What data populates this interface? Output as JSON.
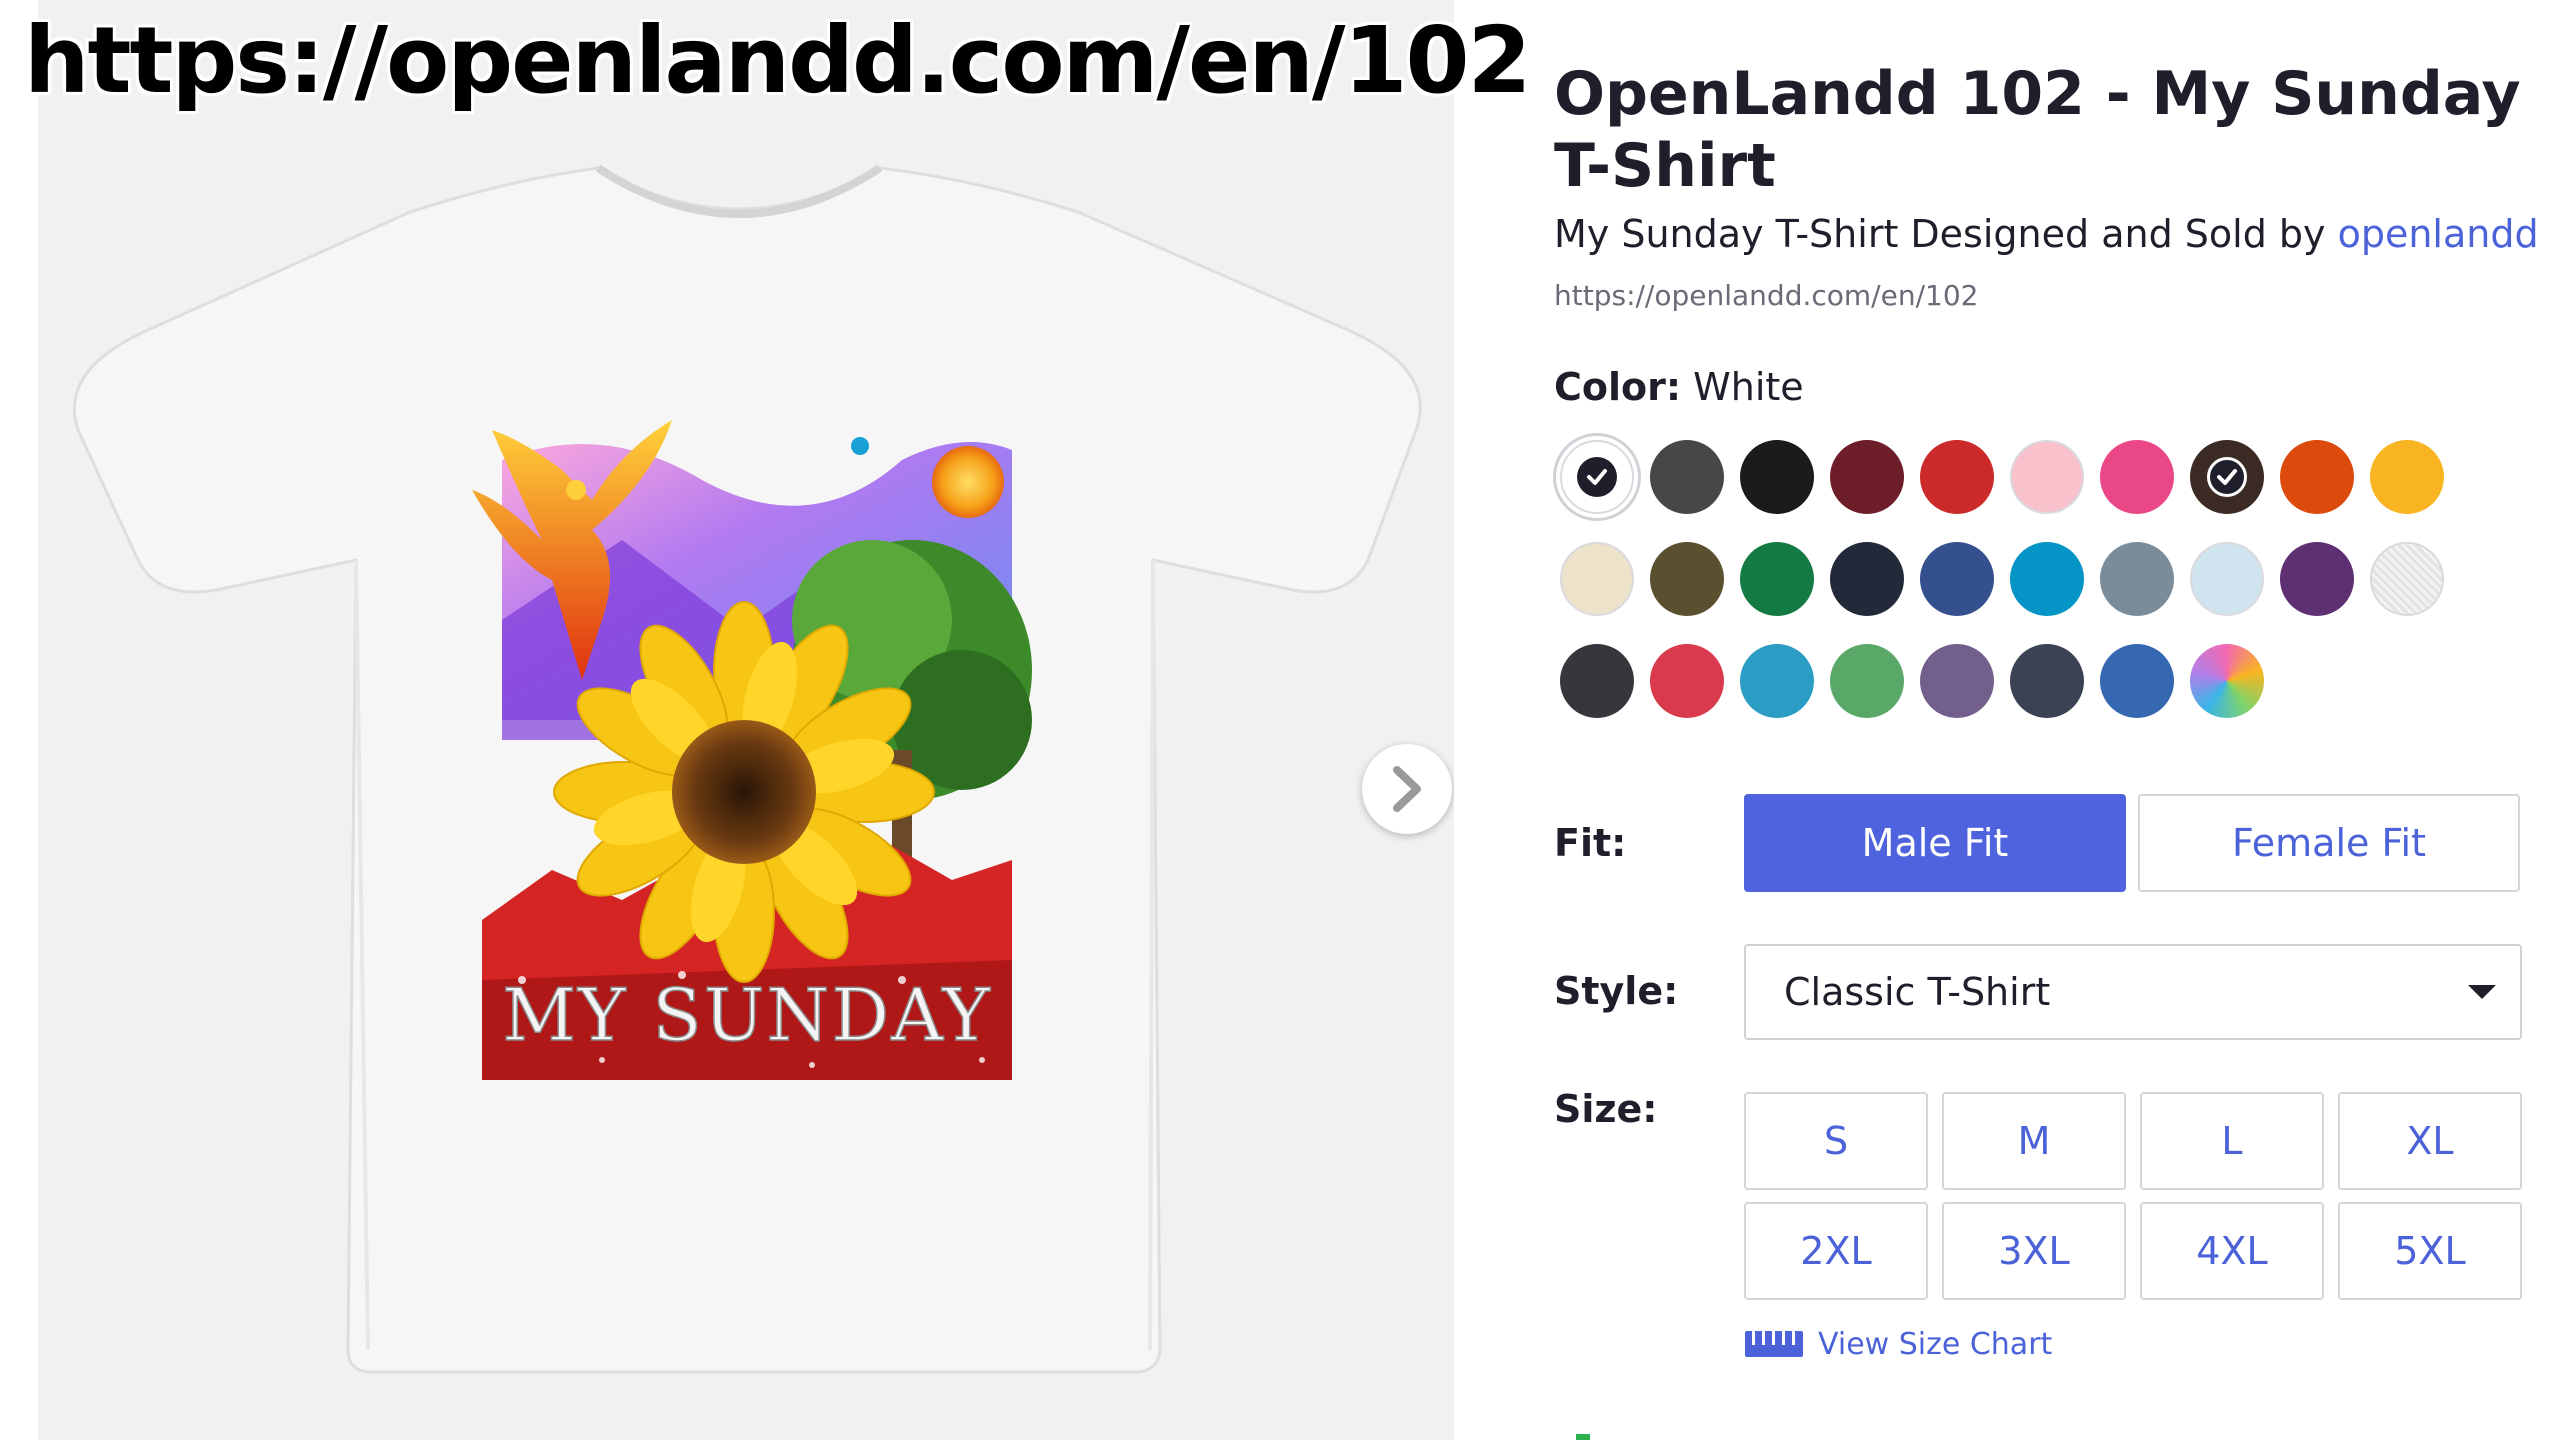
{
  "overlay_url": "https://openlandd.com/en/102",
  "product": {
    "title": "OpenLandd 102 - My Sunday T-Shirt",
    "subtitle_prefix": "My Sunday T-Shirt Designed and Sold by ",
    "seller": "openlandd",
    "source_url": "https://openlandd.com/en/102",
    "artwork_text": "MY SUNDAY"
  },
  "color": {
    "label": "Color:",
    "selected": "White",
    "swatches": [
      {
        "name": "White",
        "hex": "#ffffff",
        "selected": true
      },
      {
        "name": "Charcoal",
        "hex": "#474747"
      },
      {
        "name": "Black",
        "hex": "#1b1b1b"
      },
      {
        "name": "Maroon",
        "hex": "#6e1e28"
      },
      {
        "name": "Red",
        "hex": "#cc2a2a"
      },
      {
        "name": "Light Pink",
        "hex": "#f8c1cc"
      },
      {
        "name": "Pink",
        "hex": "#ea4787"
      },
      {
        "name": "Brown",
        "hex": "#3b2b24",
        "checked": true
      },
      {
        "name": "Orange",
        "hex": "#dc4a0c"
      },
      {
        "name": "Gold",
        "hex": "#f9b521"
      },
      {
        "name": "Cream",
        "hex": "#ede3cb"
      },
      {
        "name": "Olive",
        "hex": "#5a4f2e"
      },
      {
        "name": "Kelly Green",
        "hex": "#137a43"
      },
      {
        "name": "Navy",
        "hex": "#222a3a"
      },
      {
        "name": "Royal Blue",
        "hex": "#35508e"
      },
      {
        "name": "Turquoise",
        "hex": "#0594c6"
      },
      {
        "name": "Slate",
        "hex": "#7a8b99"
      },
      {
        "name": "Light Blue",
        "hex": "#cfe4ef"
      },
      {
        "name": "Purple",
        "hex": "#5e2f72"
      },
      {
        "name": "Heather Grey",
        "hex": "#e8e8e8",
        "heather": true
      },
      {
        "name": "Heather Charcoal",
        "hex": "#36373c"
      },
      {
        "name": "Heather Red",
        "hex": "#d93a4d"
      },
      {
        "name": "Heather Turquoise",
        "hex": "#2b9cc4"
      },
      {
        "name": "Heather Green",
        "hex": "#5aa868"
      },
      {
        "name": "Heather Purple",
        "hex": "#735f8c"
      },
      {
        "name": "Heather Navy",
        "hex": "#3a4254"
      },
      {
        "name": "Heather Royal",
        "hex": "#3568b0"
      },
      {
        "name": "Tie Dye",
        "hex": "#f3a64a",
        "tiedye": true
      }
    ]
  },
  "fit": {
    "label": "Fit:",
    "options": [
      "Male Fit",
      "Female Fit"
    ],
    "selected": "Male Fit"
  },
  "style": {
    "label": "Style:",
    "value": "Classic T-Shirt"
  },
  "size": {
    "label": "Size:",
    "options": [
      "S",
      "M",
      "L",
      "XL",
      "2XL",
      "3XL",
      "4XL",
      "5XL"
    ],
    "chart_link": "View Size Chart"
  },
  "colors": {
    "accent": "#4f63de",
    "link": "#4b62d8",
    "text": "#1f1f2c"
  }
}
